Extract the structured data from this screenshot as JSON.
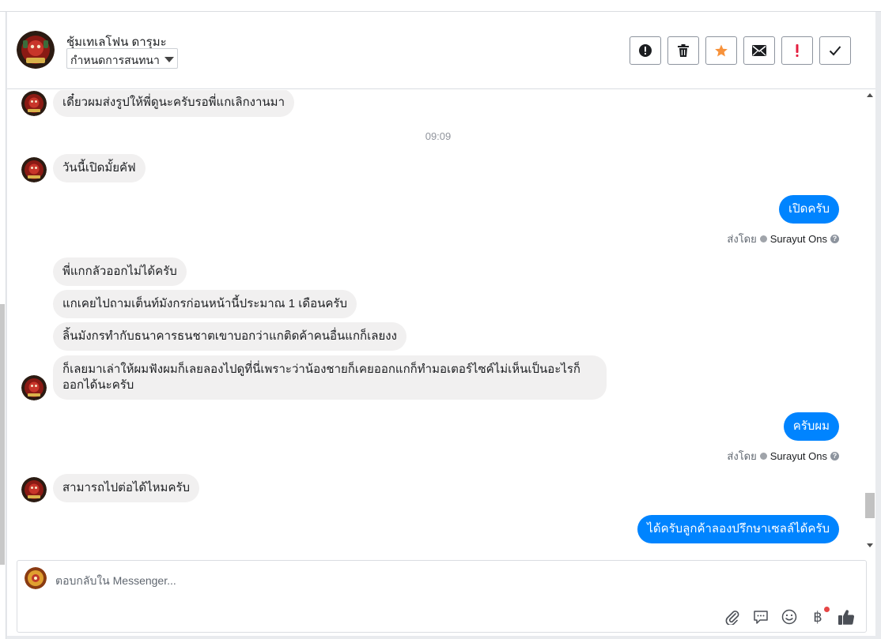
{
  "header": {
    "contact_name": "ชุ้มเทเลโฟน ดารุมะ",
    "label_select": "กำหนดการสนทนา",
    "actions": [
      {
        "name": "spam-button",
        "icon": "alert-circle-icon"
      },
      {
        "name": "delete-button",
        "icon": "trash-icon"
      },
      {
        "name": "star-button",
        "icon": "star-icon",
        "color": "#f7923b"
      },
      {
        "name": "mark-unread-button",
        "icon": "envelope-icon"
      },
      {
        "name": "follow-up-button",
        "icon": "exclamation-icon",
        "color": "#e41e3f"
      },
      {
        "name": "mark-done-button",
        "icon": "check-icon"
      }
    ]
  },
  "thread": {
    "messages": [
      {
        "dir": "in",
        "text": "เดี๋ยวผมส่งรูปให้พี่ดูนะครับรอพี่แกเลิกงานมา"
      },
      {
        "type": "time",
        "text": "09:09"
      },
      {
        "dir": "in",
        "text": "วันนี้เปิดมั้ยคัฟ"
      },
      {
        "dir": "out",
        "text": "เปิดครับ"
      },
      {
        "type": "sentby",
        "prefix": "ส่งโดย",
        "agent": "Surayut Ons"
      },
      {
        "dir": "in",
        "text": "พี่แกกลัวออกไม่ได้ครับ"
      },
      {
        "dir": "in",
        "text": "แกเคยไปถามเต็นท์มังกรก่อนหน้านี้ประมาณ 1 เดือนครับ"
      },
      {
        "dir": "in",
        "text": "ลิ้นมังกรทำกับธนาคารธนชาตเขาบอกว่าแกติดค้าคนอื่นแกก็เลยงง"
      },
      {
        "dir": "in",
        "text": "ก็เลยมาเล่าให้ผมฟังผมก็เลยลองไปดูที่นี่เพราะว่าน้องชายก็เคยออกแกก็ทำมอเตอร์ไซค์ไม่เห็นเป็นอะไรก็ออกได้นะครับ"
      },
      {
        "dir": "out",
        "text": "ครับผม"
      },
      {
        "type": "sentby",
        "prefix": "ส่งโดย",
        "agent": "Surayut Ons"
      },
      {
        "dir": "in",
        "text": "สามารถไปต่อได้ไหมครับ"
      },
      {
        "dir": "out",
        "text": "ได้ครับลูกค้าลองปรึกษาเซลล์ได้ครับ"
      }
    ]
  },
  "composer": {
    "placeholder": "ตอบกลับใน Messenger...",
    "tools": [
      "paperclip-icon",
      "saved-reply-icon",
      "emoji-icon",
      "baht-payment-icon",
      "thumbs-up-icon"
    ],
    "baht_symbol": "฿"
  },
  "colors": {
    "outgoing_bubble": "#0084ff",
    "incoming_bubble": "#f1f0f0",
    "star": "#f7923b",
    "alert": "#e41e3f"
  }
}
